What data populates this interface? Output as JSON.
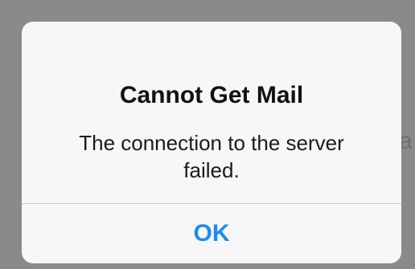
{
  "background": {
    "partial_text": "a"
  },
  "alert": {
    "title": "Cannot Get Mail",
    "message": "The connection to the server failed.",
    "button_label": "OK"
  },
  "colors": {
    "dim_overlay": "#8a8a8a",
    "alert_background": "#f7f7f7",
    "title_text": "#111111",
    "message_text": "#1a1a1a",
    "divider": "#c8c8cc",
    "button_tint": "#1a8cf0"
  }
}
